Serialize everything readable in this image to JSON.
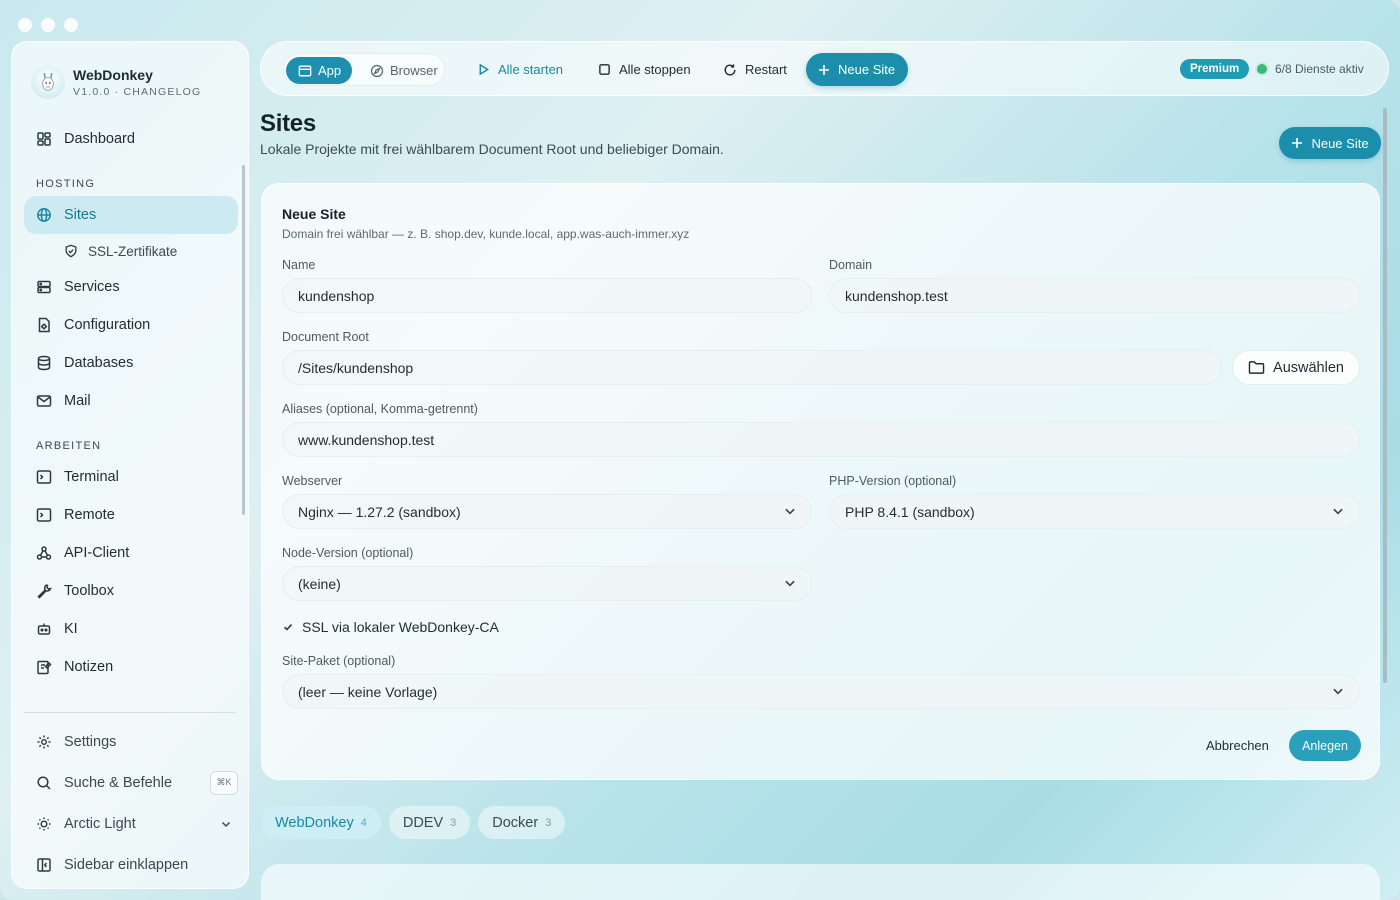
{
  "app": {
    "name": "WebDonkey",
    "version": "V1.0.0 · CHANGELOG"
  },
  "sidebar": {
    "nav": [
      {
        "label": "Dashboard",
        "icon": "dashboard-icon"
      },
      {
        "section": "HOSTING"
      },
      {
        "label": "Sites",
        "icon": "globe-icon",
        "active": true
      },
      {
        "label": "SSL-Zertifikate",
        "icon": "shield-icon",
        "sub": true
      },
      {
        "label": "Services",
        "icon": "server-icon"
      },
      {
        "label": "Configuration",
        "icon": "config-file-icon"
      },
      {
        "label": "Databases",
        "icon": "database-icon"
      },
      {
        "label": "Mail",
        "icon": "mail-icon"
      },
      {
        "section": "ARBEITEN"
      },
      {
        "label": "Terminal",
        "icon": "terminal-icon"
      },
      {
        "label": "Remote",
        "icon": "remote-icon"
      },
      {
        "label": "API-Client",
        "icon": "webhook-icon"
      },
      {
        "label": "Toolbox",
        "icon": "wrench-icon"
      },
      {
        "label": "KI",
        "icon": "bot-icon"
      },
      {
        "label": "Notizen",
        "icon": "notes-icon"
      }
    ],
    "bottom": {
      "settings": "Settings",
      "search": "Suche & Befehle",
      "search_shortcut": "⌘K",
      "theme": "Arctic Light",
      "collapse": "Sidebar einklappen"
    }
  },
  "toolbar": {
    "mode_app": "App",
    "mode_browser": "Browser",
    "start_all": "Alle starten",
    "stop_all": "Alle stoppen",
    "restart": "Restart",
    "new_site": "Neue Site",
    "premium": "Premium",
    "services_status": "6/8 Dienste aktiv"
  },
  "page": {
    "title": "Sites",
    "subtitle": "Lokale Projekte mit frei wählbarem Document Root und beliebiger Domain.",
    "new_site": "Neue Site"
  },
  "form": {
    "title": "Neue Site",
    "subtitle": "Domain frei wählbar — z. B. shop.dev, kunde.local, app.was-auch-immer.xyz",
    "name_label": "Name",
    "name_value": "kundenshop",
    "domain_label": "Domain",
    "domain_value": "kundenshop.test",
    "docroot_label": "Document Root",
    "docroot_value": "/Sites/kundenshop",
    "choose_button": "Auswählen",
    "aliases_label": "Aliases (optional, Komma-getrennt)",
    "aliases_value": "www.kundenshop.test",
    "webserver_label": "Webserver",
    "webserver_value": "Nginx — 1.27.2 (sandbox)",
    "php_label": "PHP-Version (optional)",
    "php_value": "PHP 8.4.1 (sandbox)",
    "node_label": "Node-Version (optional)",
    "node_value": "(keine)",
    "ssl_label": "SSL via lokaler WebDonkey-CA",
    "ssl_checked": true,
    "package_label": "Site-Paket (optional)",
    "package_value": "(leer — keine Vorlage)",
    "cancel": "Abbrechen",
    "create": "Anlegen"
  },
  "tabs": [
    {
      "label": "WebDonkey",
      "count": "4",
      "active": true
    },
    {
      "label": "DDEV",
      "count": "3"
    },
    {
      "label": "Docker",
      "count": "3"
    }
  ],
  "colors": {
    "accent": "#1c8eab",
    "status_ok": "#38b97a"
  }
}
